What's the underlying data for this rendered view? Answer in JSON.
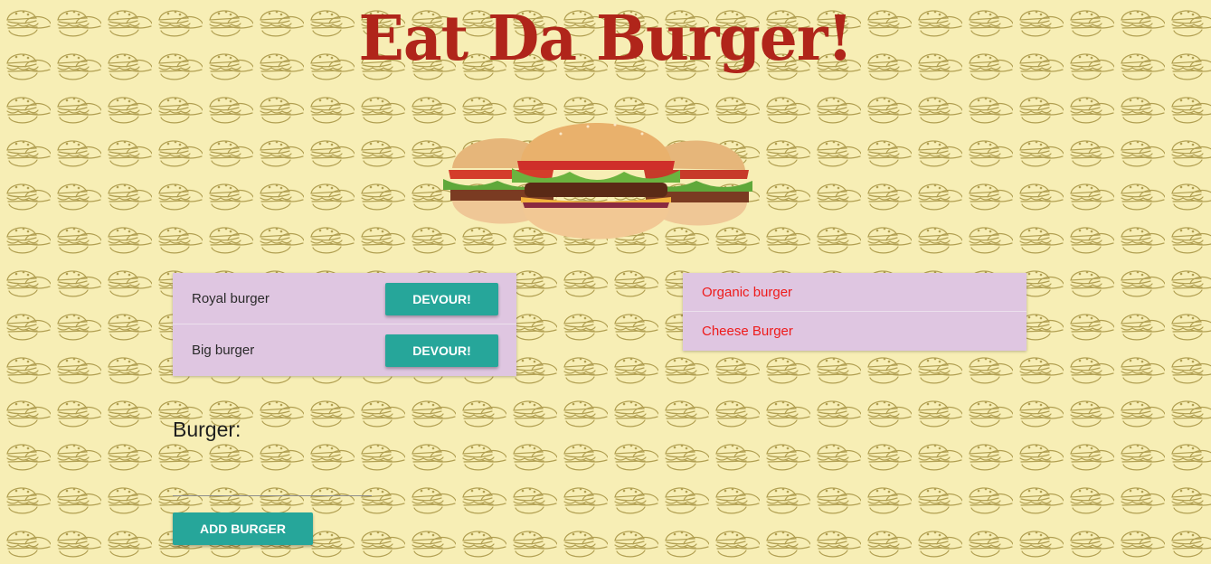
{
  "header": {
    "title": "Eat Da Burger!"
  },
  "hero": {
    "icon": "burger-trio-image"
  },
  "uneaten": {
    "items": [
      {
        "name": "Royal burger",
        "button_label": "Devour!"
      },
      {
        "name": "Big burger",
        "button_label": "Devour!"
      }
    ]
  },
  "devoured": {
    "items": [
      {
        "name": "Organic burger"
      },
      {
        "name": "Cheese Burger"
      }
    ]
  },
  "form": {
    "label": "Burger:",
    "input_value": "",
    "submit_label": "Add Burger"
  },
  "colors": {
    "background": "#f7eeb5",
    "pattern": "#8c7a2a",
    "title": "#b0251a",
    "list_bg": "#dfc6e1",
    "button": "#26a69a",
    "devoured_text": "#ee1b1b"
  }
}
